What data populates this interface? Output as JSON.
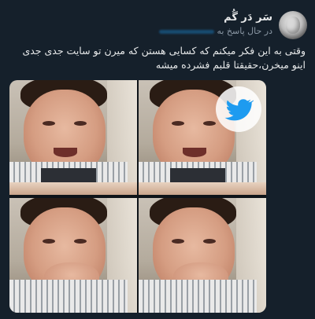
{
  "tweet": {
    "author_name": "سَر دَر گُم",
    "reply_prefix": "در حال پاسخ به",
    "text": "وقتی به این فکر میکنم که کسایی هستن که میرن تو سایت جدی جدی اینو میخرن،حقیقتا قلبم فشرده میشه"
  },
  "media": {
    "panels": [
      "crying-boy-1",
      "crying-boy-2",
      "crying-boy-3",
      "crying-boy-4"
    ],
    "watermark_icon": "twitter-bird-icon"
  },
  "colors": {
    "background": "#15202b",
    "text": "#e7e9ea",
    "secondary_text": "#8b98a5",
    "accent": "#1d9bf0"
  }
}
